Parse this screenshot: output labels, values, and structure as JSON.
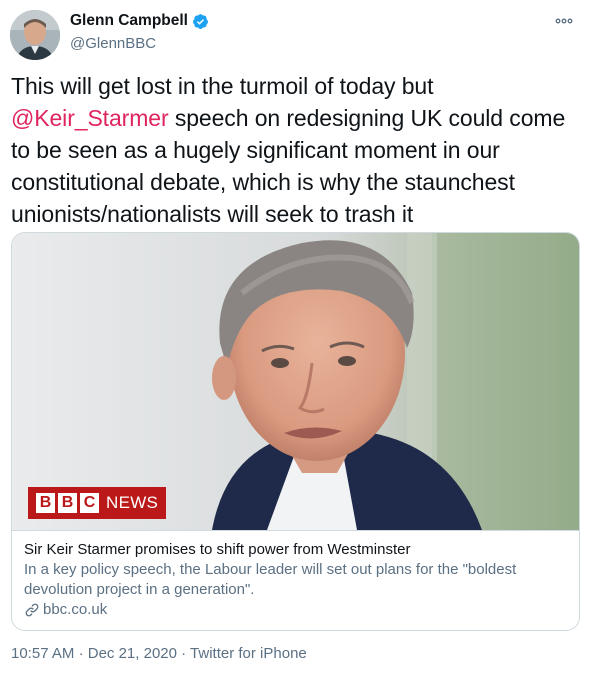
{
  "author": {
    "display_name": "Glenn Campbell",
    "handle": "@GlennBBC",
    "verified_icon": "verified-badge-icon",
    "accent_color": "#1da1f2"
  },
  "tweet": {
    "text_before": "This will get lost in the turmoil of today but ",
    "mention": "@Keir_Starmer",
    "text_after": " speech on redesigning UK could come to be seen as a hugely significant moment in our constitutional debate, which is why the staunchest unionists/nationalists will seek to trash it",
    "mention_color": "#e0245e"
  },
  "card": {
    "logo_letters": [
      "B",
      "B",
      "C"
    ],
    "logo_word": "NEWS",
    "title": "Sir Keir Starmer promises to shift power from Westminster",
    "description": "In a key policy speech, the Labour leader will set out plans for the \"boldest devolution project in a generation\".",
    "domain": "bbc.co.uk",
    "logo_color": "#bb1919"
  },
  "meta": {
    "time": "10:57 AM",
    "separator": "·",
    "date": "Dec 21, 2020",
    "source": "Twitter for iPhone"
  }
}
